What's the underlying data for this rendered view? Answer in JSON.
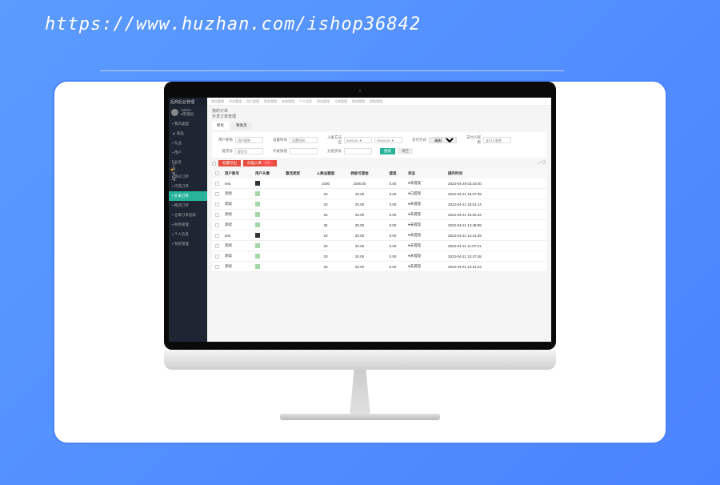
{
  "watermark": "https://www.huzhan.com/ishop36842",
  "brand": "后商后台管理",
  "user": {
    "name": "Admin",
    "role": "●管理员"
  },
  "nav": [
    {
      "label": "▪ 我的桌面",
      "active": false,
      "dot": false
    },
    {
      "label": "▲ 商品",
      "active": false,
      "dot": false
    },
    {
      "label": "▪ 礼品",
      "active": false,
      "dot": false
    },
    {
      "label": "▪ 用户",
      "active": false,
      "dot": false
    },
    {
      "label": "▪ 业务",
      "active": false,
      "dot": false
    },
    {
      "label": "▪ 订单管理",
      "active": false,
      "dot": true
    },
    {
      "label": "▪ 等价订单",
      "active": false,
      "dot": false
    },
    {
      "label": "▪ 代充订单",
      "active": false,
      "dot": false
    },
    {
      "label": "▪ 外发订单",
      "active": true,
      "dot": false
    },
    {
      "label": "▪ 物流订单",
      "active": false,
      "dot": false
    },
    {
      "label": "▪ 仓库订单追踪",
      "active": false,
      "dot": false
    },
    {
      "label": "▪ 财务管理",
      "active": false,
      "dot": false
    },
    {
      "label": "▪ 个人信息",
      "active": false,
      "dot": false
    },
    {
      "label": "▪ 系统管理",
      "active": false,
      "dot": false
    }
  ],
  "topmenu": [
    "商品管理",
    "代充管理",
    "用户管理",
    "财务管理",
    "系统管理",
    "个人信息",
    "网站管理",
    "订单管理",
    "物流管理",
    "帮助管理"
  ],
  "crumb": {
    "l1": "我的订单",
    "l2": "外发订单管理"
  },
  "tabs": [
    {
      "label": "所有",
      "active": true
    },
    {
      "label": "预发货",
      "active": false
    }
  ],
  "filters": {
    "f1": {
      "label": "用户昵称",
      "ph": "用户昵称"
    },
    "f2": {
      "label": "设置时间",
      "ph": "设置时间"
    },
    "f3": {
      "label": "入账方法应",
      "ph1": "¥495.00 ▼",
      "ph2": "¥3000.00 ▼"
    },
    "f4": {
      "label": "支付方式",
      "ph": "请选择"
    },
    "f5": {
      "label": "支付人昵称",
      "ph": "支付人昵称"
    },
    "f6": {
      "label": "提货号",
      "ph": "提货号"
    },
    "f7": {
      "label": "代发快递",
      "ph": ""
    },
    "f8": {
      "label": "分提货号",
      "ph": ""
    },
    "btn1": "搜索",
    "btn2": "清空"
  },
  "actions": {
    "b1": "批量导出",
    "b2": "扫描入库",
    "badge": "0个"
  },
  "cols": {
    "c2": "用户账号",
    "c3": "用户头像",
    "c4": "激活类型",
    "c5": "入款总额度",
    "c6": "佣金可提金",
    "c7": "提现",
    "c8": "状态",
    "c9": "操作时间"
  },
  "rows": [
    {
      "acc": "test",
      "type": "b",
      "act": "1000",
      "amt": "1000.00",
      "com": "0.00",
      "st": "●未提现",
      "time": "2023-04-29 03:43:40"
    },
    {
      "acc": "测试",
      "type": "g",
      "act": "20",
      "amt": "20.00",
      "com": "0.00",
      "st": "●已提现",
      "time": "2023-04-21 18:07:39"
    },
    {
      "acc": "测试",
      "type": "g",
      "act": "20",
      "amt": "20.00",
      "com": "0.00",
      "st": "●未提现",
      "time": "2023-04-21 18:01:14"
    },
    {
      "acc": "测试",
      "type": "g",
      "act": "25",
      "amt": "25.00",
      "com": "0.00",
      "st": "●未提现",
      "time": "2023-04-21 15:59:42"
    },
    {
      "acc": "测试",
      "type": "g",
      "act": "25",
      "amt": "25.00",
      "com": "0.00",
      "st": "●未提现",
      "time": "2023-04-21 14:48:08"
    },
    {
      "acc": "test",
      "type": "b",
      "act": "20",
      "amt": "20.00",
      "com": "0.00",
      "st": "●未提现",
      "time": "2023-04-21 14:41:39"
    },
    {
      "acc": "测试",
      "type": "g",
      "act": "20",
      "amt": "20.00",
      "com": "0.00",
      "st": "●未提现",
      "time": "2023-04-21 11:07:21"
    },
    {
      "acc": "测试",
      "type": "g",
      "act": "20",
      "amt": "20.00",
      "com": "0.00",
      "st": "●未提现",
      "time": "2023-04-21 10:47:48"
    },
    {
      "acc": "测试",
      "type": "g",
      "act": "20",
      "amt": "20.00",
      "com": "0.00",
      "st": "●未提现",
      "time": "2023-04-21 10:24:23"
    }
  ]
}
